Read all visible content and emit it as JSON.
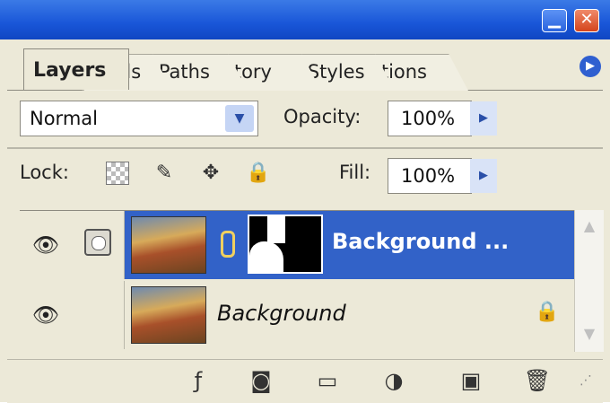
{
  "window": {
    "minimize_icon": "minimize-icon",
    "close_icon": "close-icon"
  },
  "tabs": [
    {
      "label": "Layers"
    },
    {
      "label": "nnels"
    },
    {
      "label": "Paths"
    },
    {
      "label": "tory"
    },
    {
      "label": "Styles"
    },
    {
      "label": "tions"
    }
  ],
  "blend_mode": {
    "value": "Normal"
  },
  "opacity": {
    "label": "Opacity:",
    "value": "100%"
  },
  "lock": {
    "label": "Lock:"
  },
  "fill": {
    "label": "Fill:",
    "value": "100%"
  },
  "layers": [
    {
      "name": "Background ...",
      "selected": true,
      "has_mask": true
    },
    {
      "name": "Background",
      "selected": false,
      "locked": true
    }
  ],
  "colors": {
    "selection": "#3262c8",
    "panel": "#ece9d8",
    "titlebar": "#1956d8"
  }
}
